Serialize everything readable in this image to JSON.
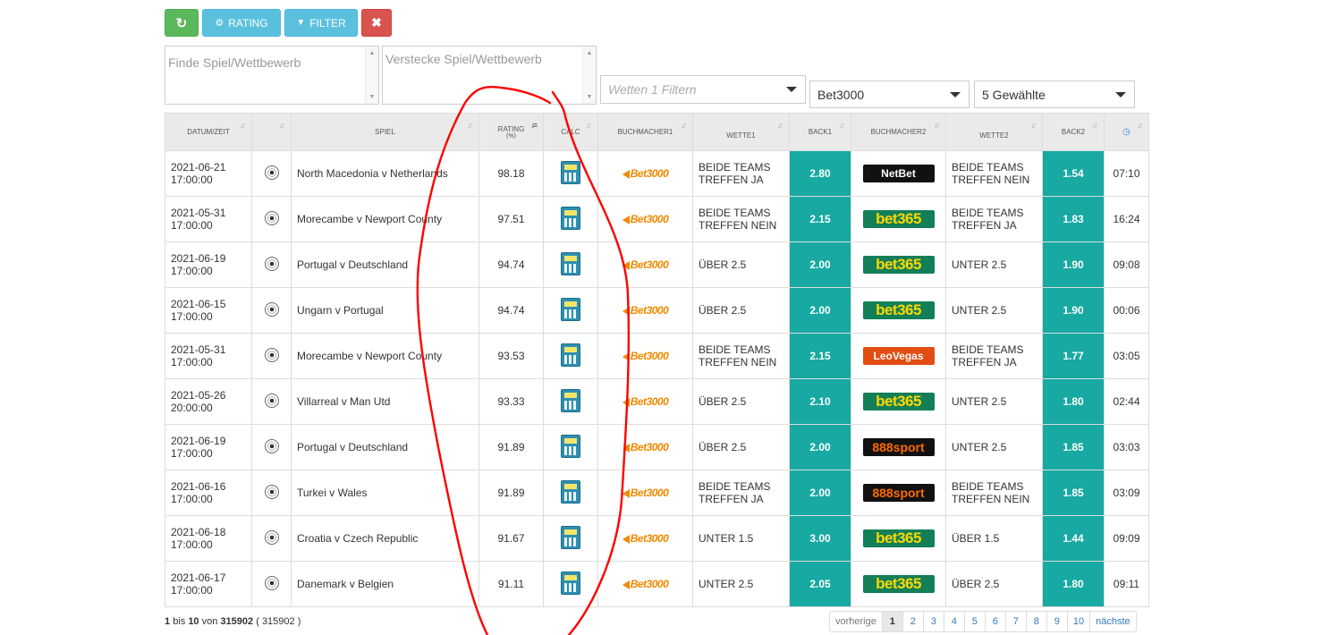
{
  "toolbar": {
    "refresh_icon": "↻",
    "rating_label": "RATING",
    "rating_icon": "⚙",
    "filter_label": "FILTER",
    "filter_icon": "▼",
    "close_label": "✖"
  },
  "filters": {
    "find_placeholder": "Finde Spiel/Wettbewerb",
    "hide_placeholder": "Verstecke Spiel/Wettbewerb",
    "bet_filter_placeholder": "Wetten 1 Filtern",
    "bookmaker_selected": "Bet3000",
    "selection_summary": "5 Gewählte"
  },
  "table": {
    "headers": {
      "datetime": "DATUM/ZEIT",
      "sport": "",
      "match": "SPIEL",
      "rating": "RATING",
      "rating_unit": "(%)",
      "calc": "CALC",
      "bookmaker1": "BUCHMACHER1",
      "bet1": "WETTE1",
      "back1": "BACK1",
      "bookmaker2": "BUCHMACHER2",
      "bet2": "WETTE2",
      "back2": "BACK2"
    },
    "rows": [
      {
        "date": "2021-06-21",
        "time": "17:00:00",
        "match": "North Macedonia v Netherlands",
        "rating": "98.18",
        "bm1": "Bet3000",
        "bet1": "BEIDE TEAMS TREFFEN JA",
        "back1": "2.80",
        "bm2": "NetBet",
        "bet2": "BEIDE TEAMS TREFFEN NEIN",
        "back2": "1.54",
        "clock": "07:10"
      },
      {
        "date": "2021-05-31",
        "time": "17:00:00",
        "match": "Morecambe v Newport County",
        "rating": "97.51",
        "bm1": "Bet3000",
        "bet1": "BEIDE TEAMS TREFFEN NEIN",
        "back1": "2.15",
        "bm2": "bet365",
        "bet2": "BEIDE TEAMS TREFFEN JA",
        "back2": "1.83",
        "clock": "16:24"
      },
      {
        "date": "2021-06-19",
        "time": "17:00:00",
        "match": "Portugal v Deutschland",
        "rating": "94.74",
        "bm1": "Bet3000",
        "bet1": "ÜBER 2.5",
        "back1": "2.00",
        "bm2": "bet365",
        "bet2": "UNTER 2.5",
        "back2": "1.90",
        "clock": "09:08"
      },
      {
        "date": "2021-06-15",
        "time": "17:00:00",
        "match": "Ungarn v Portugal",
        "rating": "94.74",
        "bm1": "Bet3000",
        "bet1": "ÜBER 2.5",
        "back1": "2.00",
        "bm2": "bet365",
        "bet2": "UNTER 2.5",
        "back2": "1.90",
        "clock": "00:06"
      },
      {
        "date": "2021-05-31",
        "time": "17:00:00",
        "match": "Morecambe v Newport County",
        "rating": "93.53",
        "bm1": "Bet3000",
        "bet1": "BEIDE TEAMS TREFFEN NEIN",
        "back1": "2.15",
        "bm2": "LeoVegas",
        "bet2": "BEIDE TEAMS TREFFEN JA",
        "back2": "1.77",
        "clock": "03:05"
      },
      {
        "date": "2021-05-26",
        "time": "20:00:00",
        "match": "Villarreal v Man Utd",
        "rating": "93.33",
        "bm1": "Bet3000",
        "bet1": "ÜBER 2.5",
        "back1": "2.10",
        "bm2": "bet365",
        "bet2": "UNTER 2.5",
        "back2": "1.80",
        "clock": "02:44"
      },
      {
        "date": "2021-06-19",
        "time": "17:00:00",
        "match": "Portugal v Deutschland",
        "rating": "91.89",
        "bm1": "Bet3000",
        "bet1": "ÜBER 2.5",
        "back1": "2.00",
        "bm2": "888sport",
        "bet2": "UNTER 2.5",
        "back2": "1.85",
        "clock": "03:03"
      },
      {
        "date": "2021-06-16",
        "time": "17:00:00",
        "match": "Turkei v Wales",
        "rating": "91.89",
        "bm1": "Bet3000",
        "bet1": "BEIDE TEAMS TREFFEN JA",
        "back1": "2.00",
        "bm2": "888sport",
        "bet2": "BEIDE TEAMS TREFFEN NEIN",
        "back2": "1.85",
        "clock": "03:09"
      },
      {
        "date": "2021-06-18",
        "time": "17:00:00",
        "match": "Croatia v Czech Republic",
        "rating": "91.67",
        "bm1": "Bet3000",
        "bet1": "UNTER 1.5",
        "back1": "3.00",
        "bm2": "bet365",
        "bet2": "ÜBER 1.5",
        "back2": "1.44",
        "clock": "09:09"
      },
      {
        "date": "2021-06-17",
        "time": "17:00:00",
        "match": "Danemark v Belgien",
        "rating": "91.11",
        "bm1": "Bet3000",
        "bet1": "UNTER 2.5",
        "back1": "2.05",
        "bm2": "bet365",
        "bet2": "ÜBER 2.5",
        "back2": "1.80",
        "clock": "09:11"
      }
    ]
  },
  "footer": {
    "from": "1",
    "bis": "bis",
    "to": "10",
    "von": "von",
    "total": "315902",
    "total_paren": "( 315902 )"
  },
  "pagination": {
    "prev": "vorherige",
    "pages": [
      "1",
      "2",
      "3",
      "4",
      "5",
      "6",
      "7",
      "8",
      "9",
      "10"
    ],
    "active_page": "1",
    "next": "nächste"
  },
  "colors": {
    "back_cell": "#17a9a2",
    "annotation": "#ff0000"
  },
  "icons": {
    "sport": "soccer-ball-icon",
    "calc": "calculator-icon",
    "clock": "clock-icon"
  }
}
